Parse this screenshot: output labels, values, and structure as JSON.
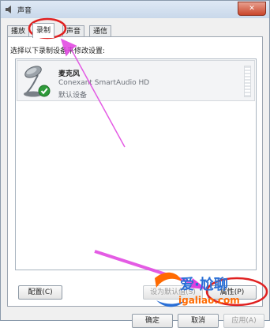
{
  "window": {
    "title": "声音",
    "close_glyph": "✕"
  },
  "tabs": [
    {
      "label": "播放"
    },
    {
      "label": "录制"
    },
    {
      "label": "声音"
    },
    {
      "label": "通信"
    }
  ],
  "recording": {
    "instruction": "选择以下录制设备来修改设置:",
    "device": {
      "name": "麦克风",
      "description": "Conexant SmartAudio HD",
      "status": "默认设备",
      "icon": "microphone-icon",
      "status_icon": "check-icon"
    }
  },
  "buttons": {
    "configure": "配置(C)",
    "set_default": "设为默认值(S)",
    "properties": "属性(P)",
    "ok": "确定",
    "cancel": "取消",
    "apply": "应用(A)"
  },
  "watermark": {
    "brand": "爱·尬聊",
    "url": "igaliao.com"
  },
  "colors": {
    "annotation": "#e040e0",
    "highlight_ring": "#e02020",
    "accent": "#3a78c9"
  }
}
